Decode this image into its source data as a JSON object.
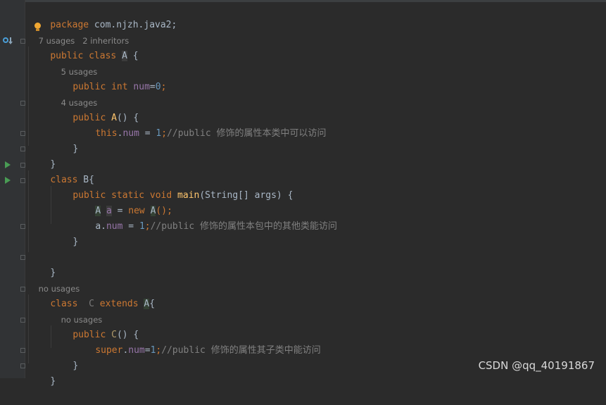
{
  "code": {
    "l1": {
      "kw": "package",
      "rest": " com.njzh.java2;"
    },
    "h1": {
      "usages": "7 usages",
      "inheritors": "2 inheritors"
    },
    "l2": {
      "kw1": "public",
      "kw2": "class",
      "name": "A",
      "rest": " {"
    },
    "h2": {
      "text": "5 usages"
    },
    "l3": {
      "kw1": "public",
      "kw2": "int",
      "field": "num",
      "op": "=",
      "num": "0",
      "end": ";"
    },
    "h3": {
      "text": "4 usages"
    },
    "l4": {
      "kw": "public",
      "ctor": "A",
      "rest": "() {"
    },
    "l5": {
      "this": "this",
      "dot": ".",
      "field": "num",
      "op": " = ",
      "num": "1",
      "semi": ";",
      "comment": "//public 修饰的属性本类中可以访问"
    },
    "l6": {
      "text": "}"
    },
    "l7": {
      "text": "}"
    },
    "l8": {
      "kw": "class",
      "rest": " B{"
    },
    "l9": {
      "kw1": "public",
      "kw2": "static",
      "kw3": "void",
      "fn": "main",
      "rest": "(String[] args) {"
    },
    "l10": {
      "type": "A",
      "var": "a",
      "op": " = ",
      "kw": "new",
      "ctor": "A",
      "rest": "();"
    },
    "l11": {
      "var": "a",
      "dot": ".",
      "field": "num",
      "op": " = ",
      "num": "1",
      "semi": ";",
      "comment": "//public 修饰的属性本包中的其他类能访问"
    },
    "l12": {
      "text": "}"
    },
    "l13": {
      "text": "}"
    },
    "h4": {
      "text": "no usages"
    },
    "l14": {
      "kw1": "class",
      "name": "C",
      "kw2": "extends",
      "parent": "A",
      "rest": "{"
    },
    "h5": {
      "text": "no usages"
    },
    "l15": {
      "kw": "public",
      "ctor": "C",
      "rest": "() {"
    },
    "l16": {
      "kw": "super",
      "dot": ".",
      "field": "num",
      "op": "=",
      "num": "1",
      "semi": ";",
      "comment": "//public 修饰的属性其子类中能访问"
    },
    "l17": {
      "text": "}"
    },
    "l18": {
      "text": "}"
    }
  },
  "watermark": "CSDN @qq_40191867"
}
